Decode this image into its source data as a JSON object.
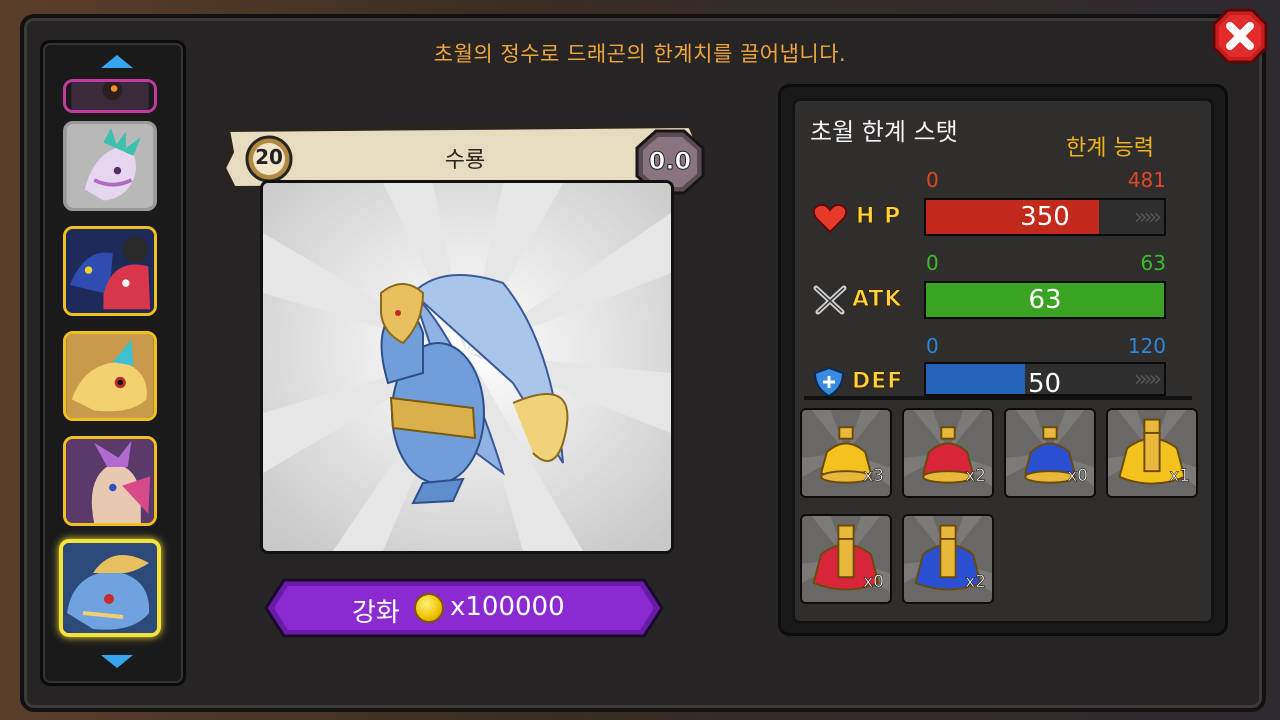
{
  "header": {
    "instruction": "초월의 정수로 드래곤의 한계치를 끌어냅니다."
  },
  "card": {
    "level": "20",
    "name": "수룡",
    "rating": "0.0"
  },
  "upgrade": {
    "label": "강화",
    "cost": "x100000"
  },
  "stats": {
    "title": "초월 한계 스탯",
    "subtitle": "한계 능력",
    "rows": [
      {
        "label": "H P",
        "min": "0",
        "max": "481",
        "value": "350",
        "fill_fraction": 0.728,
        "color": "#c22a1c",
        "min_color": "#e0462a",
        "max_color": "#e0462a"
      },
      {
        "label": "ATK",
        "min": "0",
        "max": "63",
        "value": "63",
        "fill_fraction": 1.0,
        "color": "#3aa322",
        "min_color": "#3dbb2c",
        "max_color": "#3dbb2c"
      },
      {
        "label": "DEF",
        "min": "0",
        "max": "120",
        "value": "50",
        "fill_fraction": 0.417,
        "color": "#2364b8",
        "min_color": "#2e86d6",
        "max_color": "#2e86d6"
      }
    ]
  },
  "items": [
    {
      "icon": "yellow-potion-icon",
      "count": "x3",
      "color": "#f4c21e"
    },
    {
      "icon": "red-potion-icon",
      "count": "x2",
      "color": "#d8253a"
    },
    {
      "icon": "blue-potion-icon",
      "count": "x0",
      "color": "#2a4fd0"
    },
    {
      "icon": "large-yellow-potion-icon",
      "count": "x1",
      "color": "#f4c21e"
    },
    {
      "icon": "large-red-potion-icon",
      "count": "x0",
      "color": "#d8253a"
    },
    {
      "icon": "large-blue-potion-icon",
      "count": "x2",
      "color": "#2a4fd0"
    }
  ],
  "sidebar": {
    "portraits": [
      {
        "icon": "dragon-portrait-partial",
        "selected": false,
        "frame": "#c23aa0"
      },
      {
        "icon": "white-dragon-portrait",
        "selected": false,
        "frame": "#9a9a9a"
      },
      {
        "icon": "twin-dragon-portrait",
        "selected": false,
        "frame": "#f0c020"
      },
      {
        "icon": "yellow-dragon-portrait",
        "selected": false,
        "frame": "#f0c020"
      },
      {
        "icon": "feathered-dragon-portrait",
        "selected": false,
        "frame": "#f0c020"
      },
      {
        "icon": "water-dragon-portrait",
        "selected": true,
        "frame": "#f7e23a"
      }
    ]
  }
}
